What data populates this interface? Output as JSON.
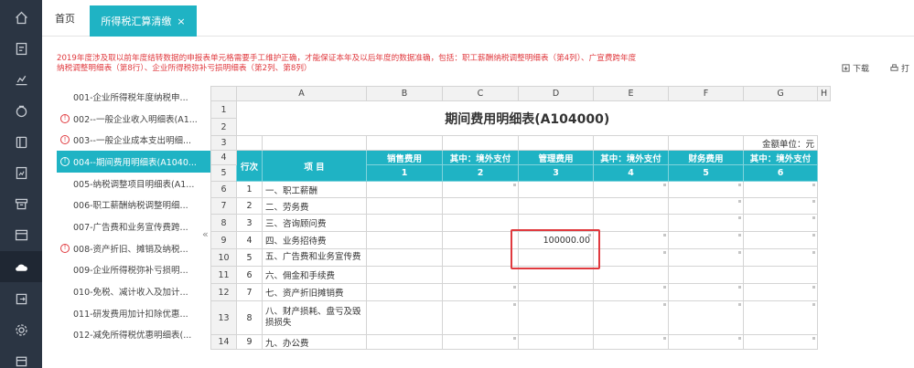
{
  "rail": {
    "icons": [
      "home-icon",
      "invoice-icon",
      "chart-icon",
      "tax-icon",
      "document-icon",
      "report-icon",
      "archive-icon",
      "ledger-icon",
      "cloud-icon",
      "export-icon",
      "settings-icon",
      "calendar-icon"
    ],
    "active": "cloud-icon"
  },
  "tabs": {
    "home": "首页",
    "active": "所得税汇算清缴",
    "close": "×"
  },
  "notice": "2019年度涉及取以前年度结转数据的申报表单元格需要手工维护正确，才能保证本年及以后年度的数据准确，包括：职工薪酬纳税调整明细表（第4列）、广宣费跨年度纳税调整明细表（第8行）、企业所得税弥补亏损明细表（第2列、第8列）",
  "toolbar": {
    "download": "下载",
    "print": "打"
  },
  "forms": [
    {
      "label": "001-企业所得税年度纳税申...",
      "warn": false,
      "selected": false
    },
    {
      "label": "002--一般企业收入明细表(A1...",
      "warn": true,
      "selected": false
    },
    {
      "label": "003--一般企业成本支出明细...",
      "warn": true,
      "selected": false
    },
    {
      "label": "004--期间费用明细表(A1040...",
      "warn": true,
      "selected": true
    },
    {
      "label": "005-纳税调整项目明细表(A1...",
      "warn": false,
      "selected": false
    },
    {
      "label": "006-职工薪酬纳税调整明细...",
      "warn": false,
      "selected": false
    },
    {
      "label": "007-广告费和业务宣传费跨...",
      "warn": false,
      "selected": false
    },
    {
      "label": "008-资产折旧、摊销及纳税...",
      "warn": true,
      "selected": false
    },
    {
      "label": "009-企业所得税弥补亏损明...",
      "warn": false,
      "selected": false
    },
    {
      "label": "010-免税、减计收入及加计...",
      "warn": false,
      "selected": false
    },
    {
      "label": "011-研发费用加计扣除优惠...",
      "warn": false,
      "selected": false
    },
    {
      "label": "012-减免所得税优惠明细表(...",
      "warn": false,
      "selected": false
    }
  ],
  "collapse": "«",
  "sheet": {
    "col_letters": [
      "A",
      "B",
      "C",
      "D",
      "E",
      "F",
      "G",
      "H"
    ],
    "row_numbers": [
      "1",
      "2",
      "3",
      "4",
      "5",
      "6",
      "7",
      "8",
      "9",
      "10",
      "11",
      "12",
      "13",
      "14"
    ],
    "title": "期间费用明细表(A104000)",
    "unit": "金额单位：元",
    "head_seq": "行次",
    "head_item": "项 目",
    "head_cols": [
      "销售费用",
      "其中：境外支付",
      "管理费用",
      "其中：境外支付",
      "财务费用",
      "其中：境外支付"
    ],
    "head_nums": [
      "1",
      "2",
      "3",
      "4",
      "5",
      "6"
    ],
    "rows": [
      {
        "seq": "1",
        "item": "一、职工薪酬",
        "values": [
          "",
          "",
          "",
          "",
          "",
          ""
        ],
        "marks": [
          false,
          true,
          false,
          true,
          true,
          true
        ]
      },
      {
        "seq": "2",
        "item": "二、劳务费",
        "values": [
          "",
          "",
          "",
          "",
          "",
          ""
        ],
        "marks": [
          false,
          false,
          false,
          false,
          true,
          true
        ]
      },
      {
        "seq": "3",
        "item": "三、咨询顾问费",
        "values": [
          "",
          "",
          "",
          "",
          "",
          ""
        ],
        "marks": [
          false,
          false,
          false,
          false,
          true,
          true
        ]
      },
      {
        "seq": "4",
        "item": "四、业务招待费",
        "values": [
          "",
          "",
          "100000.00",
          "",
          "",
          ""
        ],
        "marks": [
          false,
          false,
          true,
          true,
          true,
          true
        ]
      },
      {
        "seq": "5",
        "item": "五、广告费和业务宣传费",
        "values": [
          "",
          "",
          "",
          "",
          "",
          ""
        ],
        "marks": [
          false,
          false,
          false,
          true,
          true,
          true
        ]
      },
      {
        "seq": "6",
        "item": "六、佣金和手续费",
        "values": [
          "",
          "",
          "",
          "",
          "",
          ""
        ],
        "marks": [
          false,
          false,
          false,
          false,
          false,
          false
        ]
      },
      {
        "seq": "7",
        "item": "七、资产折旧摊销费",
        "values": [
          "",
          "",
          "",
          "",
          "",
          ""
        ],
        "marks": [
          false,
          true,
          false,
          true,
          true,
          true
        ]
      },
      {
        "seq": "8",
        "item": "八、财产损耗、盘亏及毁损损失",
        "values": [
          "",
          "",
          "",
          "",
          "",
          ""
        ],
        "marks": [
          false,
          true,
          false,
          true,
          true,
          true
        ]
      },
      {
        "seq": "9",
        "item": "九、办公费",
        "values": [
          "",
          "",
          "",
          "",
          "",
          ""
        ],
        "marks": [
          false,
          true,
          false,
          true,
          true,
          true
        ]
      }
    ]
  }
}
